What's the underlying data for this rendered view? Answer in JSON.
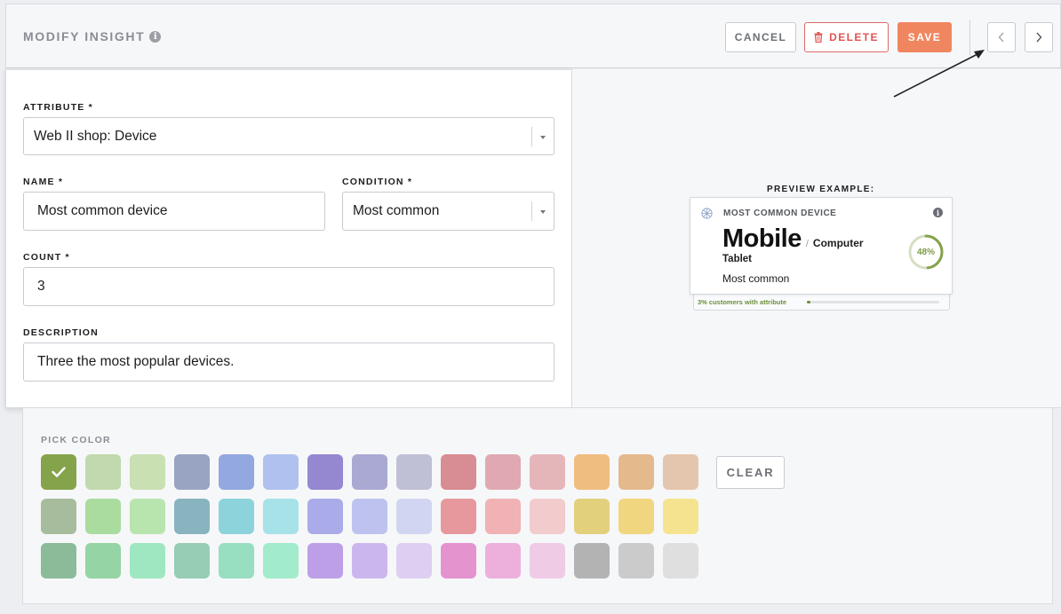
{
  "header": {
    "title": "MODIFY INSIGHT",
    "cancel_label": "CANCEL",
    "delete_label": "DELETE",
    "save_label": "SAVE"
  },
  "form": {
    "attribute_label": "ATTRIBUTE *",
    "attribute_value": "Web II shop: Device",
    "name_label": "NAME *",
    "name_value": "Most common device",
    "condition_label": "CONDITION *",
    "condition_value": "Most common",
    "count_label": "COUNT *",
    "count_value": "3",
    "description_label": "DESCRIPTION",
    "description_value": "Three the most popular devices."
  },
  "preview": {
    "label": "PREVIEW EXAMPLE:",
    "card_title": "MOST COMMON DEVICE",
    "primary_value": "Mobile",
    "separator": "/",
    "second_value": "Computer",
    "third_value": "Tablet",
    "subtitle": "Most common",
    "percent_text": "48%",
    "percent": 0.48,
    "footer_text": "3% customers with attribute",
    "footer_fraction": 0.03
  },
  "colors": {
    "label": "PICK COLOR",
    "clear_label": "CLEAR",
    "selected_index": 0,
    "check_icon": "check-icon",
    "rows": [
      [
        "#85a34b",
        "#c2d8ae",
        "#c8e0b2",
        "#98a4c1",
        "#93a8e0",
        "#b0c1ef",
        "#9587d0",
        "#a9a9d3",
        "#bfbfd6",
        "#d88c93",
        "#e0a9b2",
        "#e5b6b9",
        "#f0bd80",
        "#e4b98c",
        "#e4c6ae"
      ],
      [
        "#a6bc9c",
        "#a9dc9e",
        "#b8e5ae",
        "#88b4bf",
        "#8dd3dc",
        "#a6e2e8",
        "#a9ace9",
        "#bec2ef",
        "#d2d5f1",
        "#e6989c",
        "#f0b2b4",
        "#f2cbcd",
        "#e2d07c",
        "#f0d67e",
        "#f6e38f"
      ],
      [
        "#8bbb98",
        "#95d4a4",
        "#9fe7c1",
        "#96cdb4",
        "#98dec0",
        "#a2ebcc",
        "#bd9fe8",
        "#cbb7ee",
        "#dccff1",
        "#e493cf",
        "#edb0dd",
        "#f0cbe6",
        "#b3b3b3",
        "#cbcbcb",
        "#dfdfdf"
      ]
    ]
  }
}
